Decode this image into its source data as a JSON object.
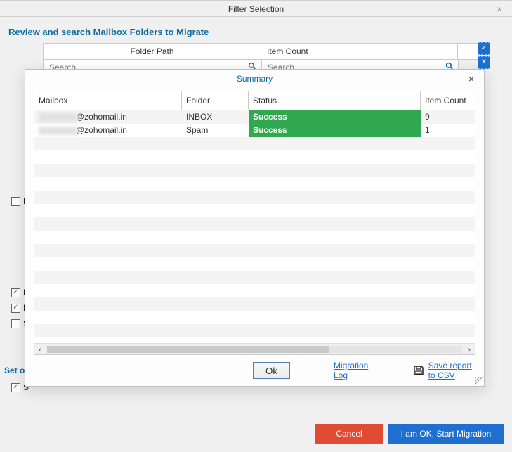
{
  "window": {
    "title": "Filter Selection",
    "close_glyph": "×"
  },
  "header": {
    "subtitle": "Review and search Mailbox Folders to Migrate"
  },
  "filter": {
    "col_path": "Folder Path",
    "col_count": "Item Count",
    "search_placeholder_left": "Search",
    "search_placeholder_right": "Search"
  },
  "side_buttons": {
    "check_all_glyph": "✓",
    "uncheck_all_glyph": "✕"
  },
  "bg_checks": {
    "d_label": "D",
    "e1_label": "E",
    "e2_label": "E",
    "s_label": "S",
    "s2_label": "S"
  },
  "set_label": "Set o",
  "modal": {
    "title": "Summary",
    "close_glyph": "×",
    "columns": {
      "mailbox": "Mailbox",
      "folder": "Folder",
      "status": "Status",
      "item_count": "Item Count"
    },
    "rows": [
      {
        "mailbox_suffix": "@zohomail.in",
        "folder": "INBOX",
        "status": "Success",
        "count": "9"
      },
      {
        "mailbox_suffix": "@zohomail.in",
        "folder": "Spam",
        "status": "Success",
        "count": "1"
      }
    ],
    "scroll": {
      "left": "‹",
      "right": "›"
    },
    "footer": {
      "ok": "Ok",
      "migration_log": "Migration Log",
      "save_csv": "Save report to CSV"
    }
  },
  "bottom": {
    "cancel": "Cancel",
    "start": "I am OK, Start Migration"
  }
}
